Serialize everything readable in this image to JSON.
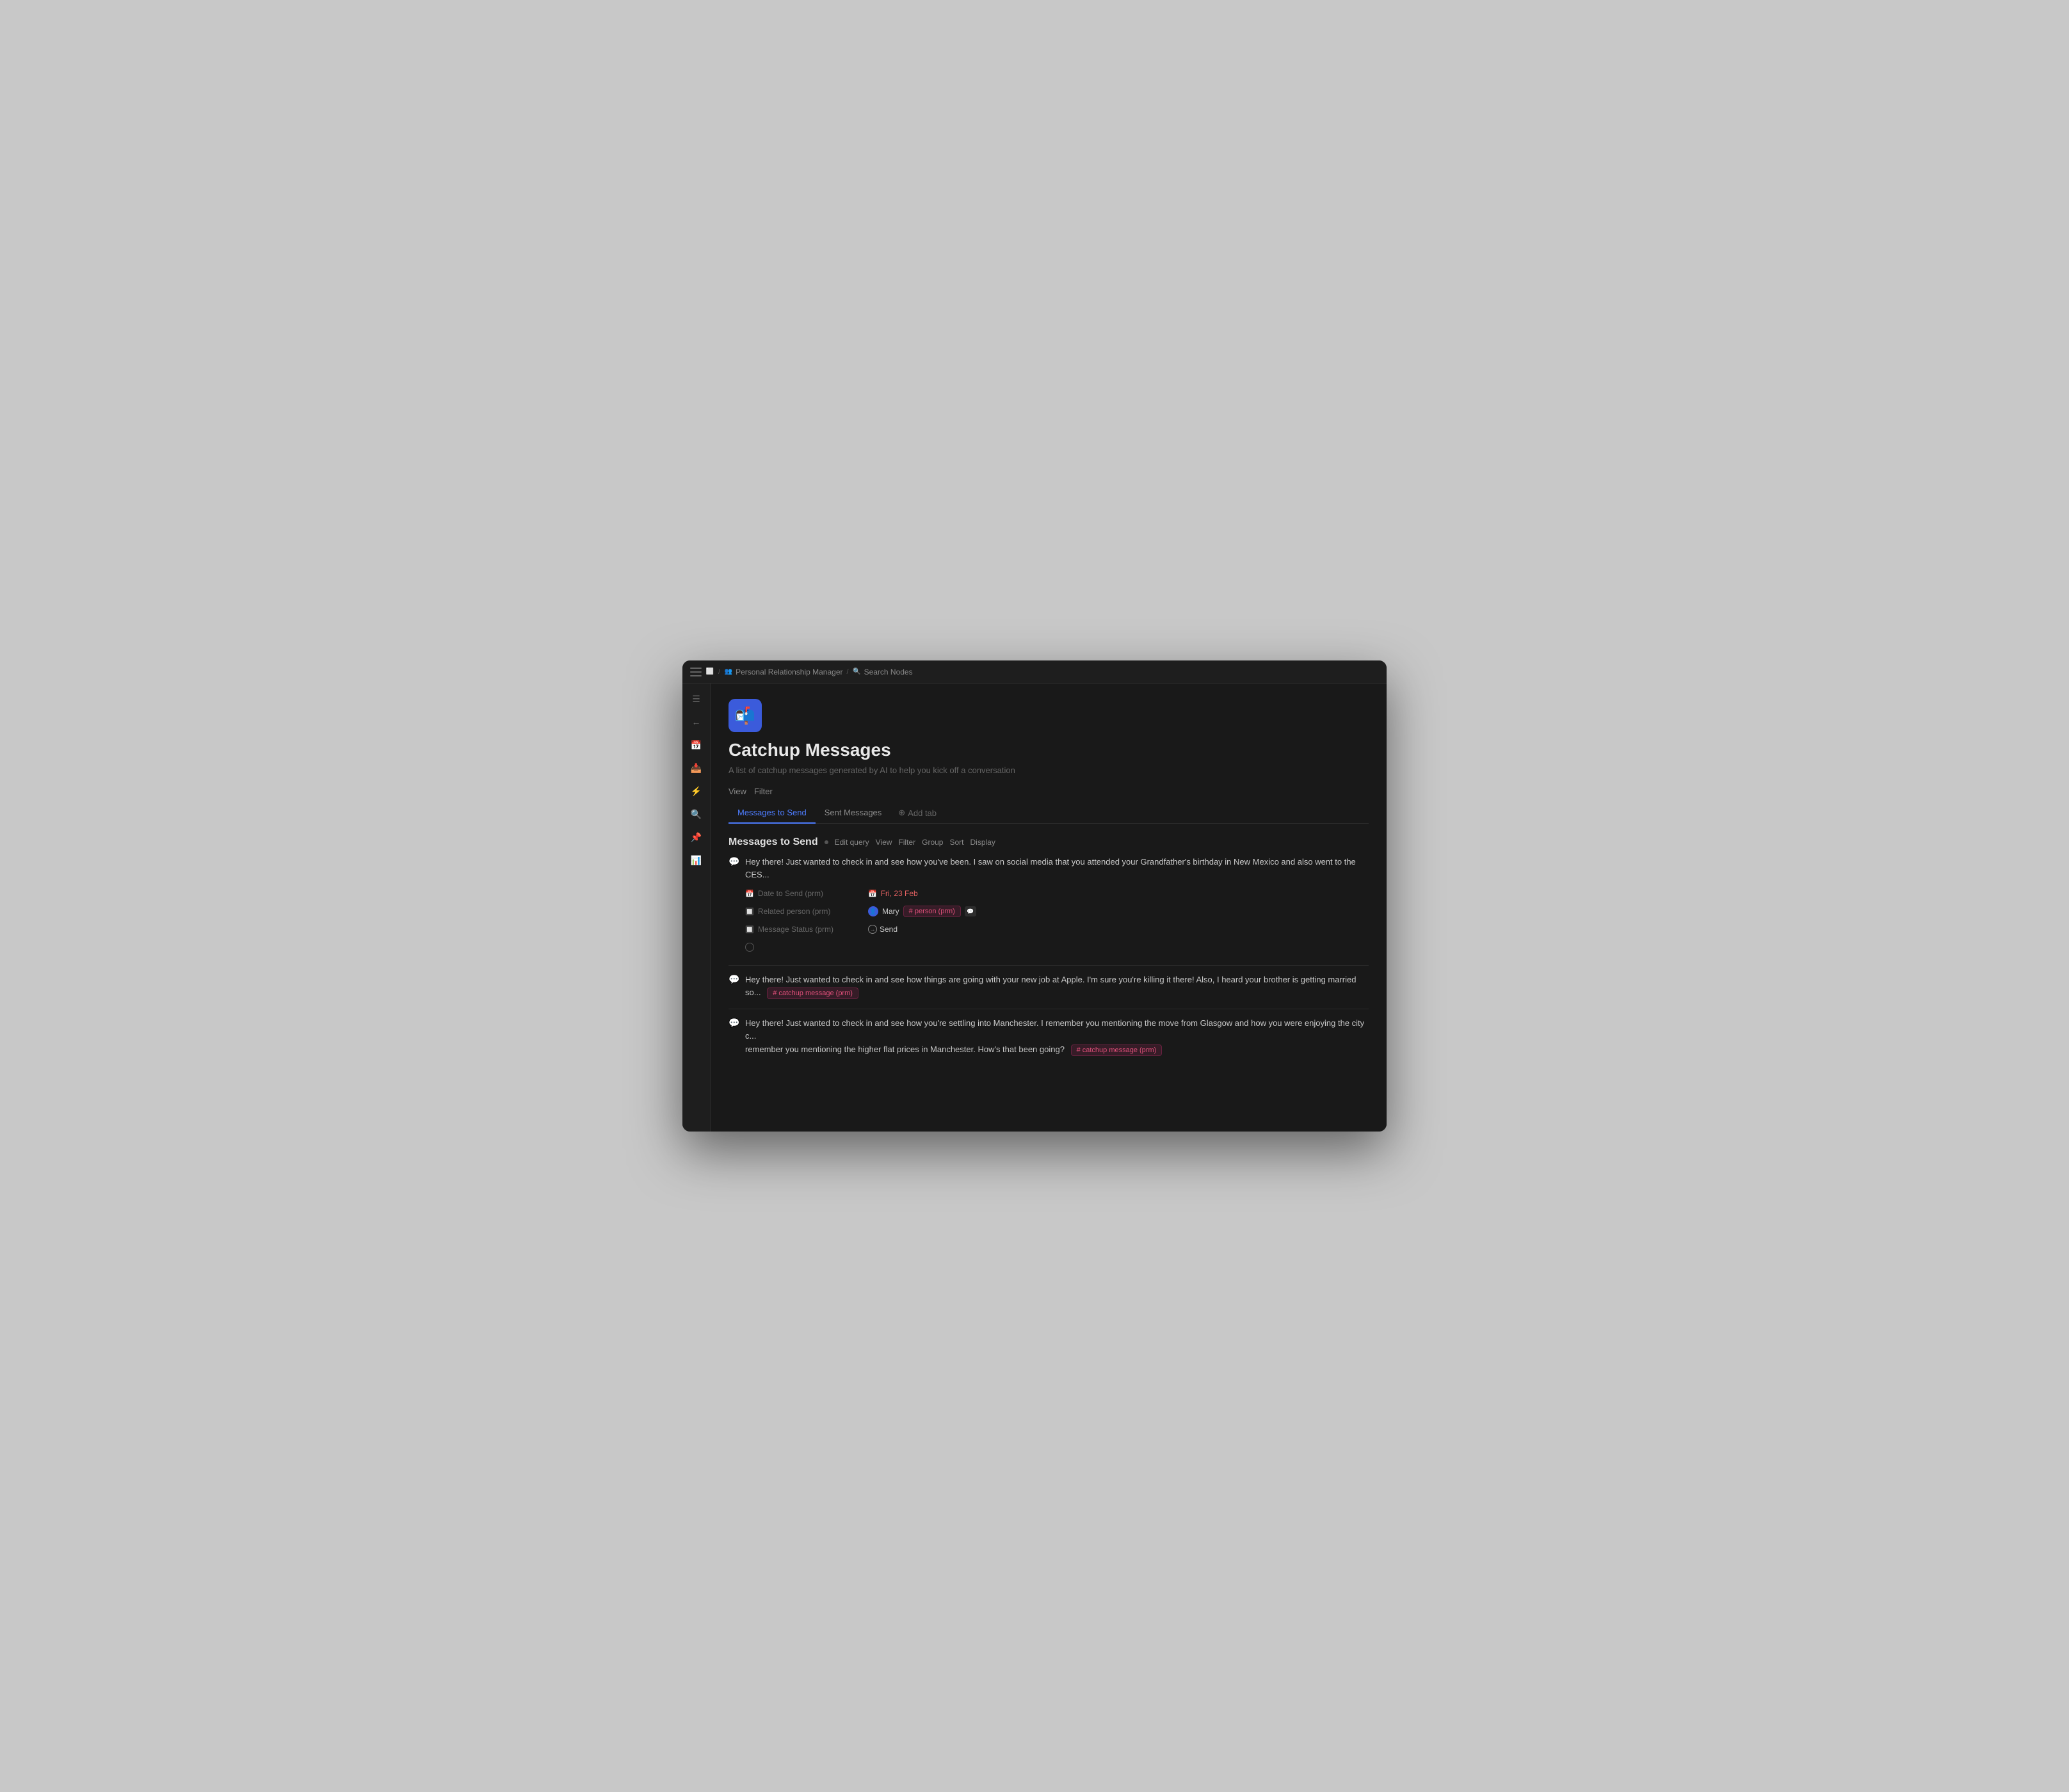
{
  "colors": {
    "accent": "#4d7cfe",
    "brand_blue": "#3b5bdb",
    "bg_main": "#191919",
    "bg_sidebar": "#1e1e1e",
    "text_primary": "#e8e8e8",
    "text_secondary": "#888",
    "text_muted": "#666",
    "chip_pink_text": "#e0507a",
    "chip_pink_bg": "rgba(220,50,120,0.15)"
  },
  "breadcrumb": {
    "items": [
      {
        "label": "Personal Relationship Manager",
        "icon": "👥"
      },
      {
        "label": "Search Nodes",
        "icon": "🔍"
      }
    ]
  },
  "page": {
    "icon": "📬",
    "title": "Catchup Messages",
    "description": "A list of catchup messages generated by AI to help you kick off a conversation"
  },
  "view_filter_bar": {
    "view_label": "View",
    "filter_label": "Filter"
  },
  "tabs": [
    {
      "label": "Messages to Send",
      "active": true
    },
    {
      "label": "Sent Messages",
      "active": false
    },
    {
      "label": "+ Add tab",
      "active": false
    }
  ],
  "query_section": {
    "title": "Messages to Send",
    "actions": [
      "Edit query",
      "View",
      "Filter",
      "Group",
      "Sort",
      "Display"
    ]
  },
  "messages": [
    {
      "id": 1,
      "text": "Hey there! Just wanted to check in and see how you've been. I saw on social media that you attended your Grandfather's birthday in New Mexico and also went to the CES...",
      "properties": {
        "date_to_send_label": "Date to Send (prm)",
        "date_to_send_value": "Fri, 23 Feb",
        "related_person_label": "Related person (prm)",
        "related_person_value": "Mary",
        "related_person_chip": "# person (prm)",
        "message_status_label": "Message Status (prm)",
        "message_status_value": "Send"
      }
    },
    {
      "id": 2,
      "text": "Hey there! Just wanted to check in and see how things are going with your new job at Apple. I'm sure you're killing it there! Also, I heard your brother is getting married so...",
      "catchup_chip": "# catchup message (prm)"
    },
    {
      "id": 3,
      "text": "Hey there! Just wanted to check in and see how you're settling into Manchester. I remember you mentioning the move from Glasgow and how you were enjoying the city c...",
      "text_continued": "remember you mentioning the higher flat prices in Manchester. How's that been going?",
      "catchup_chip": "# catchup message (prm)"
    }
  ],
  "sidebar_icons": [
    {
      "name": "sidebar-toggle",
      "symbol": "≡"
    },
    {
      "name": "back",
      "symbol": "←"
    },
    {
      "name": "calendar",
      "symbol": "📅"
    },
    {
      "name": "inbox",
      "symbol": "📥"
    },
    {
      "name": "lightning",
      "symbol": "⚡"
    },
    {
      "name": "search",
      "symbol": "🔍"
    },
    {
      "name": "pin",
      "symbol": "📌"
    },
    {
      "name": "chart",
      "symbol": "📊"
    }
  ]
}
